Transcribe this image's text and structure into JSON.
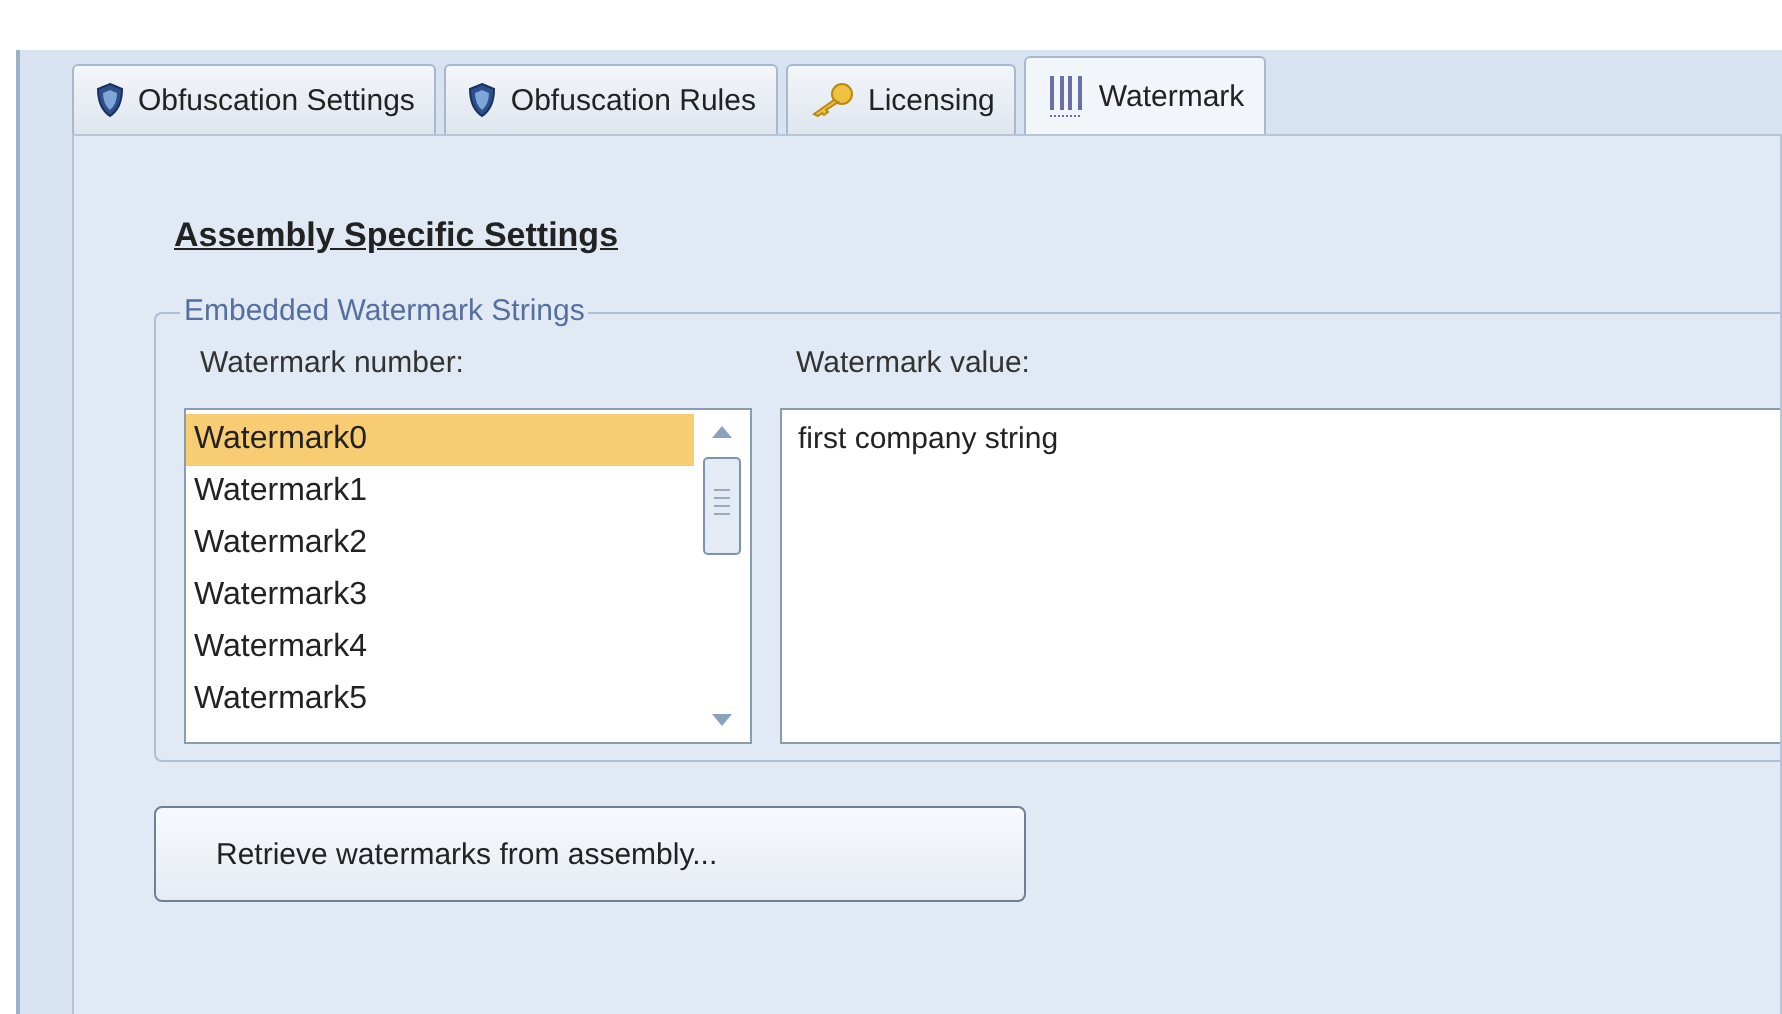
{
  "tabs": [
    {
      "label": "Obfuscation Settings",
      "kind": "shield",
      "selected": false
    },
    {
      "label": "Obfuscation Rules",
      "kind": "shield",
      "selected": false
    },
    {
      "label": "Licensing",
      "kind": "key",
      "selected": false
    },
    {
      "label": "Watermark",
      "kind": "barcode",
      "selected": true
    }
  ],
  "section_title": "Assembly Specific Settings",
  "group": {
    "title": "Embedded Watermark Strings",
    "list_label": "Watermark number:",
    "value_label": "Watermark value:",
    "items": [
      {
        "label": "Watermark0",
        "selected": true
      },
      {
        "label": "Watermark1",
        "selected": false
      },
      {
        "label": "Watermark2",
        "selected": false
      },
      {
        "label": "Watermark3",
        "selected": false
      },
      {
        "label": "Watermark4",
        "selected": false
      },
      {
        "label": "Watermark5",
        "selected": false
      }
    ],
    "value": "first company string"
  },
  "button": "Retrieve watermarks from assembly..."
}
